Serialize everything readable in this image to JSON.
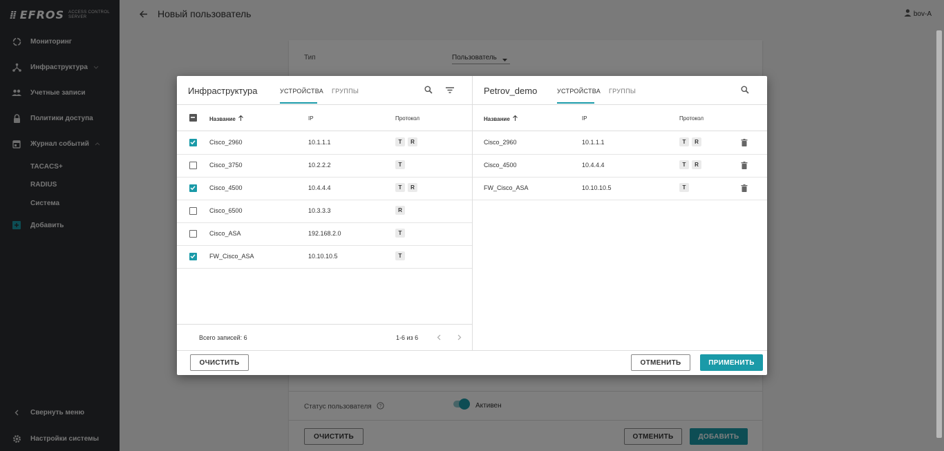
{
  "app": {
    "logo_main": "EFROS",
    "logo_sub_line1": "ACCESS CONTROL",
    "logo_sub_line2": "SERVER"
  },
  "sidebar": {
    "items": [
      {
        "label": "Мониторинг",
        "icon": "monitoring-icon"
      },
      {
        "label": "Инфраструктура",
        "icon": "infrastructure-icon"
      },
      {
        "label": "Учетные записи",
        "icon": "accounts-icon"
      },
      {
        "label": "Политики доступа",
        "icon": "lock-icon"
      },
      {
        "label": "Журнал событий",
        "icon": "calendar-icon"
      }
    ],
    "sub_items": [
      "TACACS+",
      "RADIUS",
      "Система"
    ],
    "add_label": "Добавить",
    "collapse_label": "Свернуть меню",
    "settings_label": "Настройки системы"
  },
  "header": {
    "title": "Новый пользователь",
    "user": "bov-A"
  },
  "form": {
    "type_label": "Тип",
    "type_value": "Пользователь",
    "status_label": "Статус пользователя",
    "status_value": "Активен",
    "clear_label": "ОЧИСТИТЬ",
    "cancel_label": "ОТМЕНИТЬ",
    "add_label": "ДОБАВИТЬ"
  },
  "modal": {
    "left": {
      "title": "Инфраструктура",
      "tab_devices": "УСТРОЙСТВА",
      "tab_groups": "ГРУППЫ",
      "col_name": "Название",
      "col_ip": "IP",
      "col_protocol": "Протокол",
      "rows": [
        {
          "name": "Cisco_2960",
          "ip": "10.1.1.1",
          "protocols": [
            "T",
            "R"
          ],
          "checked": true
        },
        {
          "name": "Cisco_3750",
          "ip": "10.2.2.2",
          "protocols": [
            "T"
          ],
          "checked": false
        },
        {
          "name": "Cisco_4500",
          "ip": "10.4.4.4",
          "protocols": [
            "T",
            "R"
          ],
          "checked": true
        },
        {
          "name": "Cisco_6500",
          "ip": "10.3.3.3",
          "protocols": [
            "R"
          ],
          "checked": false
        },
        {
          "name": "Cisco_ASA",
          "ip": "192.168.2.0",
          "protocols": [
            "T"
          ],
          "checked": false
        },
        {
          "name": "FW_Cisco_ASA",
          "ip": "10.10.10.5",
          "protocols": [
            "T"
          ],
          "checked": true
        }
      ],
      "total": "Всего записей: 6",
      "pagination": "1-6 из 6"
    },
    "right": {
      "title": "Petrov_demo",
      "tab_devices": "УСТРОЙСТВА",
      "tab_groups": "ГРУППЫ",
      "col_name": "Название",
      "col_ip": "IP",
      "col_protocol": "Протокол",
      "rows": [
        {
          "name": "Cisco_2960",
          "ip": "10.1.1.1",
          "protocols": [
            "T",
            "R"
          ]
        },
        {
          "name": "Cisco_4500",
          "ip": "10.4.4.4",
          "protocols": [
            "T",
            "R"
          ]
        },
        {
          "name": "FW_Cisco_ASA",
          "ip": "10.10.10.5",
          "protocols": [
            "T"
          ]
        }
      ]
    },
    "clear_label": "ОЧИСТИТЬ",
    "cancel_label": "ОТМЕНИТЬ",
    "apply_label": "ПРИМЕНИТЬ"
  },
  "colors": {
    "accent": "#1a9aa8",
    "sidebar_bg": "#2d2f33"
  }
}
